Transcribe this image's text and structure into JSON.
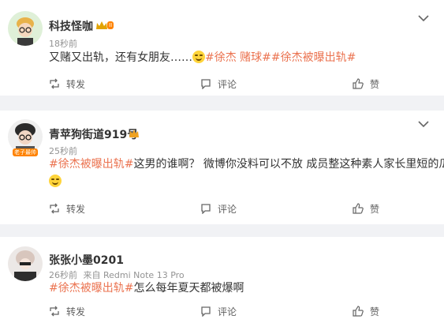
{
  "comments": [
    {
      "username": "科技怪咖",
      "time": "18秒前",
      "device": "",
      "text_plain": "又赌又出轨，还有女朋友……",
      "tags": [
        "#徐杰 赌球#",
        "#徐杰被曝出轨#"
      ],
      "actions": {
        "repost": "转发",
        "comment": "评论",
        "like": "赞"
      },
      "level_badge": "II"
    },
    {
      "username": "青苹狗街道919号",
      "time": "25秒前",
      "device": "",
      "tag_lead": "#徐杰被曝出轨#",
      "text_plain": "这男的谁啊？ 微博你没料可以不放 成员整这种素人家长里短的瓜",
      "avatar_badge": "老子最帅",
      "actions": {
        "repost": "转发",
        "comment": "评论",
        "like": "赞"
      }
    },
    {
      "username": "张张小墨0201",
      "time": "26秒前",
      "device": "来自 Redmi Note 13 Pro",
      "tag_lead": "#徐杰被曝出轨#",
      "text_plain": "怎么每年夏天都被爆啊",
      "actions": {
        "repost": "转发",
        "comment": "评论",
        "like": "赞"
      }
    }
  ],
  "colors": {
    "tag": "#eb7350",
    "badge": "#ff8200",
    "background": "#f1f2f5"
  },
  "icons": [
    "chevron-down-icon",
    "repost-icon",
    "comment-icon",
    "like-icon",
    "vip-crown-icon",
    "laugh-emoji-icon"
  ]
}
